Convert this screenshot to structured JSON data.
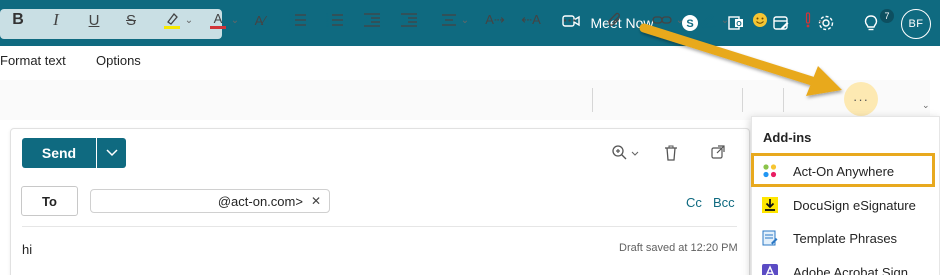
{
  "header": {
    "meet_now_label": "Meet Now",
    "notification_count": "7",
    "avatar_initials": "BF"
  },
  "ribbon": {
    "tabs": [
      {
        "label": "Format text"
      },
      {
        "label": "Options"
      }
    ]
  },
  "toolbar": {
    "more_label": "···"
  },
  "compose": {
    "send_label": "Send",
    "to_label": "To",
    "recipient_text": "@act-on.com>",
    "cc_label": "Cc",
    "bcc_label": "Bcc",
    "body_text": "hi",
    "draft_status": "Draft saved at 12:20 PM"
  },
  "addins_menu": {
    "title": "Add-ins",
    "items": [
      {
        "label": "Act-On Anywhere",
        "icon": "act-on-icon"
      },
      {
        "label": "DocuSign eSignature",
        "icon": "docusign-icon"
      },
      {
        "label": "Template Phrases",
        "icon": "template-phrases-icon"
      },
      {
        "label": "Adobe Acrobat Sign",
        "icon": "adobe-acrobat-icon"
      }
    ]
  },
  "colors": {
    "brand": "#0f6a80",
    "annotation": "#e8a91e",
    "more_button_bg": "#fde9b2"
  }
}
